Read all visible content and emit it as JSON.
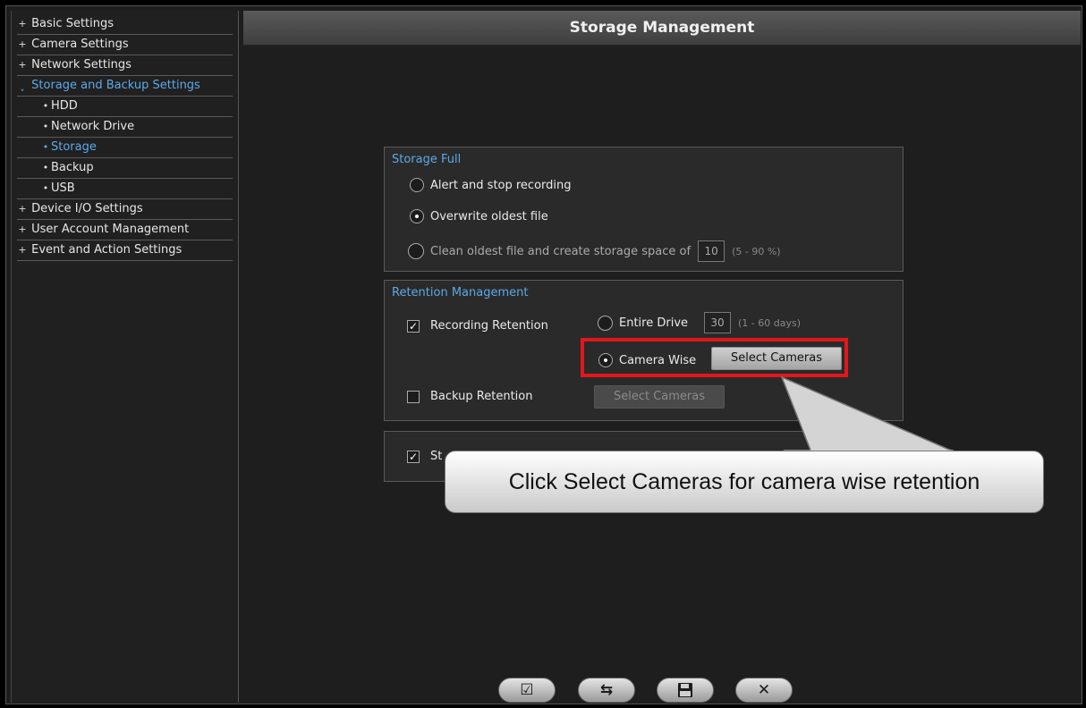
{
  "sidebar": {
    "items": [
      {
        "marker": "+",
        "label": "Basic Settings"
      },
      {
        "marker": "+",
        "label": "Camera Settings"
      },
      {
        "marker": "+",
        "label": "Network Settings"
      },
      {
        "marker": "ˬ",
        "label": "Storage and Backup Settings"
      },
      {
        "marker": "•",
        "label": "HDD"
      },
      {
        "marker": "•",
        "label": "Network Drive"
      },
      {
        "marker": "•",
        "label": "Storage"
      },
      {
        "marker": "•",
        "label": "Backup"
      },
      {
        "marker": "•",
        "label": "USB"
      },
      {
        "marker": "+",
        "label": "Device I/O Settings"
      },
      {
        "marker": "+",
        "label": "User Account Management"
      },
      {
        "marker": "+",
        "label": "Event and Action Settings"
      }
    ]
  },
  "header": {
    "title": "Storage Management"
  },
  "storage_full": {
    "title": "Storage Full",
    "options": [
      {
        "label": "Alert and stop recording",
        "selected": false
      },
      {
        "label": "Overwrite oldest file",
        "selected": true
      },
      {
        "label": "Clean oldest file and create storage space of",
        "selected": false
      }
    ],
    "space_value": "10",
    "space_hint": "(5 - 90 %)"
  },
  "retention": {
    "title": "Retention Management",
    "recording_label": "Recording Retention",
    "recording_checked": true,
    "entire_drive_label": "Entire Drive",
    "days_value": "30",
    "days_hint": "(1 - 60 days)",
    "camera_wise_label": "Camera Wise",
    "select_cameras_label": "Select Cameras",
    "backup_label": "Backup Retention",
    "backup_checked": false,
    "backup_select_label": "Select Cameras"
  },
  "bottom_panel": {
    "label_fragment": "St",
    "checked": true
  },
  "callout": {
    "text": "Click Select Cameras for camera wise retention"
  },
  "colors": {
    "accent": "#5da9e9",
    "highlight": "#e3161b",
    "panel": "#2a2a2a"
  },
  "footer": {
    "buttons": [
      {
        "icon": "apply-check-icon",
        "glyph": "☑"
      },
      {
        "icon": "reset-arrows-icon",
        "glyph": "⇆"
      },
      {
        "icon": "save-disk-icon",
        "glyph": "💾"
      },
      {
        "icon": "close-icon",
        "glyph": "✕"
      }
    ]
  }
}
